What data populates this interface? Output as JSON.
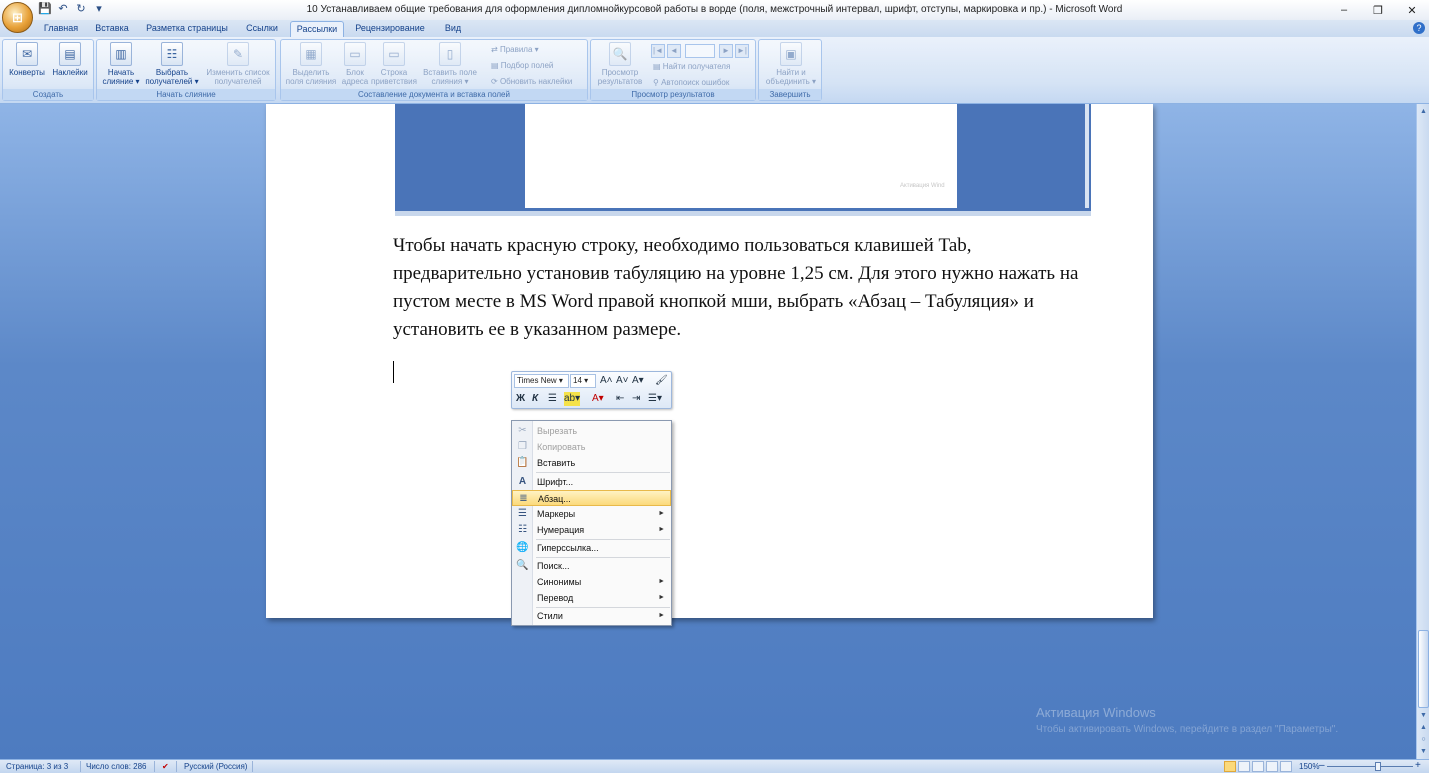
{
  "window": {
    "title": "10 Устанавливаем общие требования для оформления дипломнойкурсовой работы в ворде (поля, межстрочный интервал, шрифт, отступы, маркировка и пр.) - Microsoft Word",
    "controls": {
      "minimize": "–",
      "restore": "❐",
      "close": "✕"
    }
  },
  "qat": {
    "save": "💾",
    "undo": "↶",
    "redo": "↻",
    "customize": "▾"
  },
  "tabs": [
    "Главная",
    "Вставка",
    "Разметка страницы",
    "Ссылки",
    "Рассылки",
    "Рецензирование",
    "Вид"
  ],
  "active_tab": "Рассылки",
  "ribbon": {
    "groups": {
      "create": "Создать",
      "start_merge": "Начать слияние",
      "write_insert": "Составление документа и вставка полей",
      "preview": "Просмотр результатов",
      "finish": "Завершить"
    },
    "buttons": {
      "envelopes": "Конверты",
      "labels": "Наклейки",
      "start_merge_1": "Начать",
      "start_merge_2": "слияние ▾",
      "select_recipients_1": "Выбрать",
      "select_recipients_2": "получателей ▾",
      "edit_list_1": "Изменить список",
      "edit_list_2": "получателей",
      "highlight_1": "Выделить",
      "highlight_2": "поля слияния",
      "address_block_1": "Блок",
      "address_block_2": "адреса",
      "greeting_1": "Строка",
      "greeting_2": "приветствия",
      "insert_field_1": "Вставить поле",
      "insert_field_2": "слияния ▾",
      "rules": "Правила ▾",
      "match_fields": "Подбор полей",
      "update_labels": "Обновить наклейки",
      "preview_1": "Просмотр",
      "preview_2": "результатов",
      "find_recipient": "Найти получателя",
      "auto_check": "Автопоиск ошибок",
      "finish_merge_1": "Найти и",
      "finish_merge_2": "объединить ▾"
    },
    "nav": {
      "first": "|◄",
      "prev": "◄",
      "next": "►",
      "last": "►|"
    }
  },
  "document": {
    "paragraph": "Чтобы начать красную строку, необходимо пользоваться клавишей Tab, предварительно установив табуляцию на уровне 1,25 см. Для этого нужно нажать на пустом месте в MS Word правой кнопкой мши, выбрать «Абзац – Табуляция» и установить ее в указанном размере."
  },
  "mini_toolbar": {
    "font": "Times New ▾",
    "size": "14 ▾",
    "grow": "A˄",
    "shrink": "A˅",
    "styles": "A▾",
    "format_painter": "🖌",
    "bold": "Ж",
    "italic": "К",
    "align": "☰",
    "highlight": "ab▾",
    "font_color": "A▾",
    "dec_indent": "⇤",
    "inc_indent": "⇥",
    "bullets": "☰▾"
  },
  "context_menu": {
    "items": [
      {
        "label": "Вырезать",
        "icon": "scissors-icon",
        "glyph": "✂"
      },
      {
        "label": "Копировать",
        "icon": "copy-icon",
        "glyph": "❐"
      },
      {
        "label": "Вставить",
        "icon": "paste-icon",
        "glyph": "📋"
      },
      {
        "label": "Шрифт...",
        "icon": "font-icon",
        "glyph": "A"
      },
      {
        "label": "Абзац...",
        "icon": "paragraph-icon",
        "glyph": "≣"
      },
      {
        "label": "Маркеры",
        "icon": "bullets-icon",
        "glyph": "☰",
        "submenu": "►"
      },
      {
        "label": "Нумерация",
        "icon": "numbering-icon",
        "glyph": "☷",
        "submenu": "►"
      },
      {
        "label": "Гиперссылка...",
        "icon": "hyperlink-icon",
        "glyph": "🌐"
      },
      {
        "label": "Поиск...",
        "icon": "search-icon",
        "glyph": "🔍"
      },
      {
        "label": "Синонимы",
        "submenu": "►"
      },
      {
        "label": "Перевод",
        "submenu": "►"
      },
      {
        "label": "Стили",
        "submenu": "►"
      }
    ]
  },
  "watermark": {
    "line1": "Активация Windows",
    "line2": "Чтобы активировать Windows, перейдите в раздел \"Параметры\"."
  },
  "embedded_screenshot": {
    "watermark": "Активация Wind"
  },
  "statusbar": {
    "page": "Страница: 3 из 3",
    "words": "Число слов: 286",
    "spell_icon": "✔",
    "language": "Русский (Россия)",
    "zoom": "150%",
    "zoom_out": "–",
    "zoom_in": "+"
  },
  "scrollbar": {
    "up": "▲",
    "down": "▼",
    "prev_page": "▲",
    "select": "○",
    "next_page": "▼"
  }
}
